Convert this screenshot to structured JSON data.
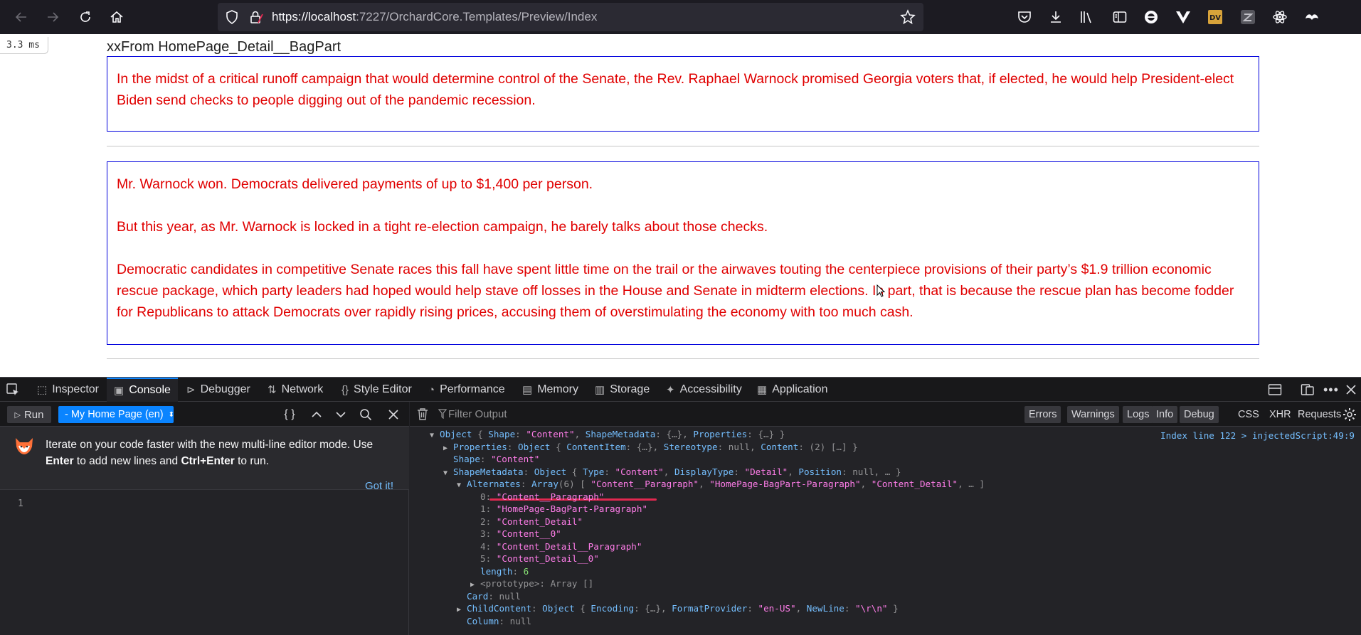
{
  "browser": {
    "url_host": "https://localhost",
    "url_rest": ":7227/OrchardCore.Templates/Preview/Index"
  },
  "page": {
    "timing": "3.3 ms",
    "heading": "xxFrom HomePage_Detail__BagPart",
    "part1": [
      "In the midst of a critical runoff campaign that would determine control of the Senate, the Rev. Raphael Warnock promised Georgia voters that, if elected, he would help President-elect Biden send checks to people digging out of the pandemic recession."
    ],
    "part2": [
      "Mr. Warnock won. Democrats delivered payments of up to $1,400 per person.",
      "But this year, as Mr. Warnock is locked in a tight re-election campaign, he barely talks about those checks.",
      "Democratic candidates in competitive Senate races this fall have spent little time on the trail or the airwaves touting the centerpiece provisions of their party’s $1.9 trillion economic rescue package, which party leaders had hoped would help stave off losses in the House and Senate in midterm elections. In part, that is because the rescue plan has become fodder for Republicans to attack Democrats over rapidly rising prices, accusing them of overstimulating the economy with too much cash."
    ]
  },
  "devtools": {
    "tabs": [
      "Inspector",
      "Console",
      "Debugger",
      "Network",
      "Style Editor",
      "Performance",
      "Memory",
      "Storage",
      "Accessibility",
      "Application"
    ],
    "run_label": "Run",
    "context": "- My Home Page (en)",
    "notice_pre": "Iterate on your code faster with the new multi-line editor mode. Use ",
    "notice_enter": "Enter",
    "notice_mid": " to add new lines and ",
    "notice_keys": "Ctrl+Enter",
    "notice_post": " to run.",
    "got_it": "Got it!",
    "line_number": "1",
    "filter_placeholder": "Filter Output",
    "filters": [
      "Errors",
      "Warnings",
      "Logs",
      "Info",
      "Debug",
      "CSS",
      "XHR",
      "Requests"
    ],
    "source_link": "Index line 122 > injectedScript:49:9"
  },
  "console_lines": [
    {
      "indent": 0,
      "twisty": "▼",
      "parts": [
        [
          "k",
          "Object "
        ],
        [
          "g",
          "{ "
        ],
        [
          "k",
          "Shape"
        ],
        [
          "g",
          ": "
        ],
        [
          "s",
          "\"Content\""
        ],
        [
          "g",
          ", "
        ],
        [
          "k",
          "ShapeMetadata"
        ],
        [
          "g",
          ": {…}, "
        ],
        [
          "k",
          "Properties"
        ],
        [
          "g",
          ": {…} }"
        ]
      ]
    },
    {
      "indent": 1,
      "twisty": "▶",
      "parts": [
        [
          "k",
          "Properties"
        ],
        [
          "g",
          ": "
        ],
        [
          "k",
          "Object "
        ],
        [
          "g",
          "{ "
        ],
        [
          "k",
          "ContentItem"
        ],
        [
          "g",
          ": {…}, "
        ],
        [
          "k",
          "Stereotype"
        ],
        [
          "g",
          ": "
        ],
        [
          "g",
          "null"
        ],
        [
          "g",
          ", "
        ],
        [
          "k",
          "Content"
        ],
        [
          "g",
          ": (2) […] }"
        ]
      ]
    },
    {
      "indent": 1,
      "twisty": "",
      "parts": [
        [
          "k",
          "Shape"
        ],
        [
          "g",
          ": "
        ],
        [
          "s",
          "\"Content\""
        ]
      ]
    },
    {
      "indent": 1,
      "twisty": "▼",
      "parts": [
        [
          "k",
          "ShapeMetadata"
        ],
        [
          "g",
          ": "
        ],
        [
          "k",
          "Object "
        ],
        [
          "g",
          "{ "
        ],
        [
          "k",
          "Type"
        ],
        [
          "g",
          ": "
        ],
        [
          "s",
          "\"Content\""
        ],
        [
          "g",
          ", "
        ],
        [
          "k",
          "DisplayType"
        ],
        [
          "g",
          ": "
        ],
        [
          "s",
          "\"Detail\""
        ],
        [
          "g",
          ", "
        ],
        [
          "k",
          "Position"
        ],
        [
          "g",
          ": "
        ],
        [
          "g",
          "null"
        ],
        [
          "g",
          ", … }"
        ]
      ]
    },
    {
      "indent": 2,
      "twisty": "▼",
      "parts": [
        [
          "k",
          "Alternates"
        ],
        [
          "g",
          ": "
        ],
        [
          "k",
          "Array"
        ],
        [
          "g",
          "(6) [ "
        ],
        [
          "s",
          "\"Content__Paragraph\""
        ],
        [
          "g",
          ", "
        ],
        [
          "s",
          "\"HomePage-BagPart-Paragraph\""
        ],
        [
          "g",
          ", "
        ],
        [
          "s",
          "\"Content_Detail\""
        ],
        [
          "g",
          ", … ]"
        ]
      ]
    },
    {
      "indent": 3,
      "twisty": "",
      "parts": [
        [
          "g",
          "0: "
        ],
        [
          "s",
          "\"Content__Paragraph\""
        ]
      ]
    },
    {
      "indent": 3,
      "twisty": "",
      "parts": [
        [
          "g",
          "1: "
        ],
        [
          "s",
          "\"HomePage-BagPart-Paragraph\""
        ]
      ]
    },
    {
      "indent": 3,
      "twisty": "",
      "parts": [
        [
          "g",
          "2: "
        ],
        [
          "s",
          "\"Content_Detail\""
        ]
      ]
    },
    {
      "indent": 3,
      "twisty": "",
      "parts": [
        [
          "g",
          "3: "
        ],
        [
          "s",
          "\"Content__0\""
        ]
      ]
    },
    {
      "indent": 3,
      "twisty": "",
      "parts": [
        [
          "g",
          "4: "
        ],
        [
          "s",
          "\"Content_Detail__Paragraph\""
        ]
      ]
    },
    {
      "indent": 3,
      "twisty": "",
      "parts": [
        [
          "g",
          "5: "
        ],
        [
          "s",
          "\"Content_Detail__0\""
        ]
      ]
    },
    {
      "indent": 3,
      "twisty": "",
      "parts": [
        [
          "k",
          "length"
        ],
        [
          "g",
          ": "
        ],
        [
          "n",
          "6"
        ]
      ]
    },
    {
      "indent": 3,
      "twisty": "▶",
      "parts": [
        [
          "g",
          "<prototype>: Array []"
        ]
      ]
    },
    {
      "indent": 2,
      "twisty": "",
      "parts": [
        [
          "k",
          "Card"
        ],
        [
          "g",
          ": null"
        ]
      ]
    },
    {
      "indent": 2,
      "twisty": "▶",
      "parts": [
        [
          "k",
          "ChildContent"
        ],
        [
          "g",
          ": "
        ],
        [
          "k",
          "Object "
        ],
        [
          "g",
          "{ "
        ],
        [
          "k",
          "Encoding"
        ],
        [
          "g",
          ": {…}, "
        ],
        [
          "k",
          "FormatProvider"
        ],
        [
          "g",
          ": "
        ],
        [
          "s",
          "\"en-US\""
        ],
        [
          "g",
          ", "
        ],
        [
          "k",
          "NewLine"
        ],
        [
          "g",
          ": "
        ],
        [
          "s",
          "\"\\r\\n\""
        ],
        [
          "g",
          " }"
        ]
      ]
    },
    {
      "indent": 2,
      "twisty": "",
      "parts": [
        [
          "k",
          "Column"
        ],
        [
          "g",
          ": null"
        ]
      ]
    }
  ]
}
